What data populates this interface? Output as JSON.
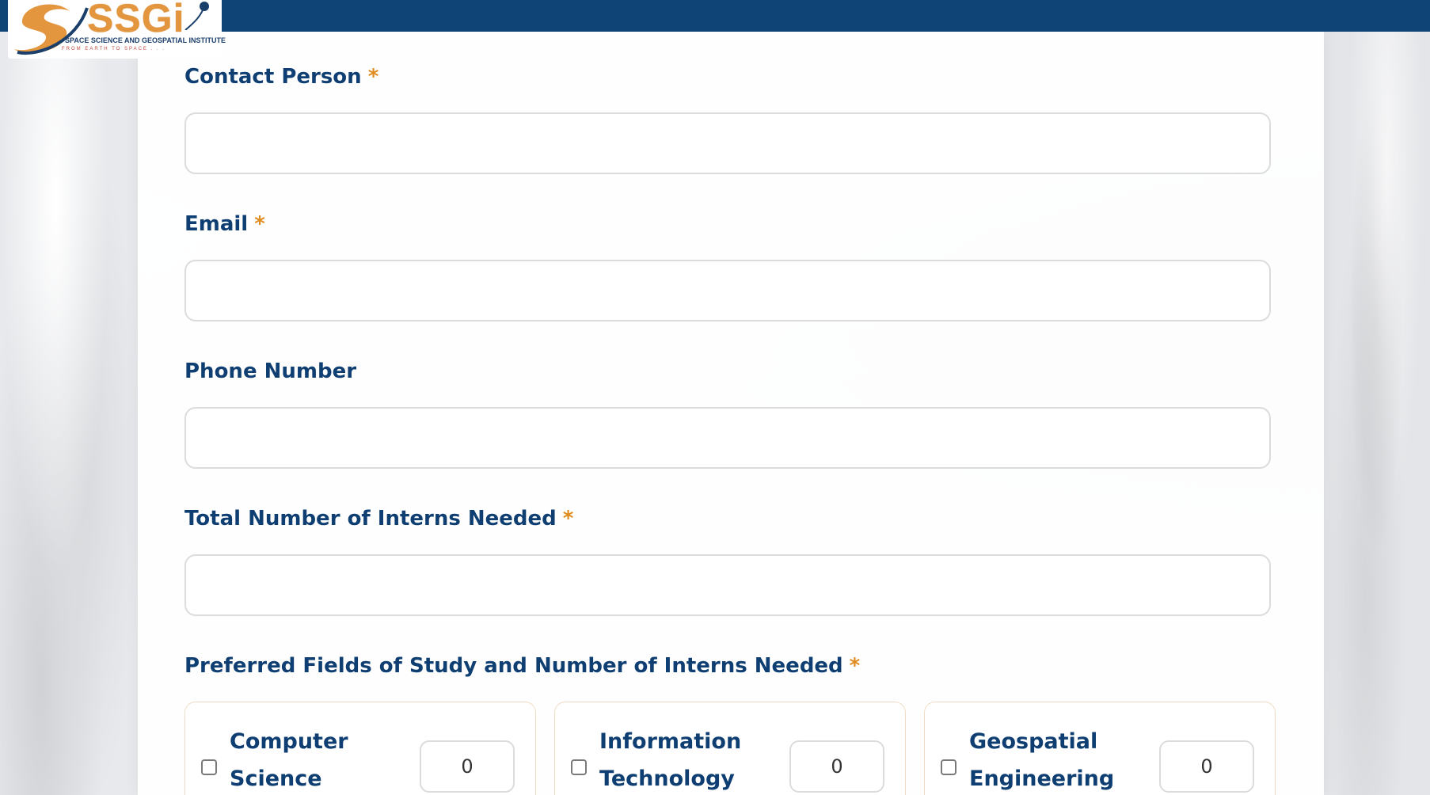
{
  "brand": {
    "logo_text": "SSGi",
    "logo_subtitle": "SPACE SCIENCE AND GEOSPATIAL INSTITUTE",
    "logo_tagline": "FROM EARTH TO SPACE . . .",
    "header_color": "#0f4477",
    "accent_color": "#e3963e"
  },
  "form": {
    "required_marker": "*",
    "contact_person": {
      "label": "Contact Person",
      "value": ""
    },
    "email": {
      "label": "Email",
      "value": ""
    },
    "phone": {
      "label": "Phone Number",
      "value": ""
    },
    "total_interns": {
      "label": "Total Number of Interns Needed",
      "value": ""
    },
    "fields_of_study": {
      "label": "Preferred Fields of Study and Number of Interns Needed",
      "options": [
        {
          "line1": "Computer",
          "line2": "Science",
          "count": "0",
          "checked": false
        },
        {
          "line1": "Information",
          "line2": "Technology",
          "count": "0",
          "checked": false
        },
        {
          "line1": "Geospatial",
          "line2": "Engineering",
          "count": "0",
          "checked": false
        }
      ]
    }
  }
}
